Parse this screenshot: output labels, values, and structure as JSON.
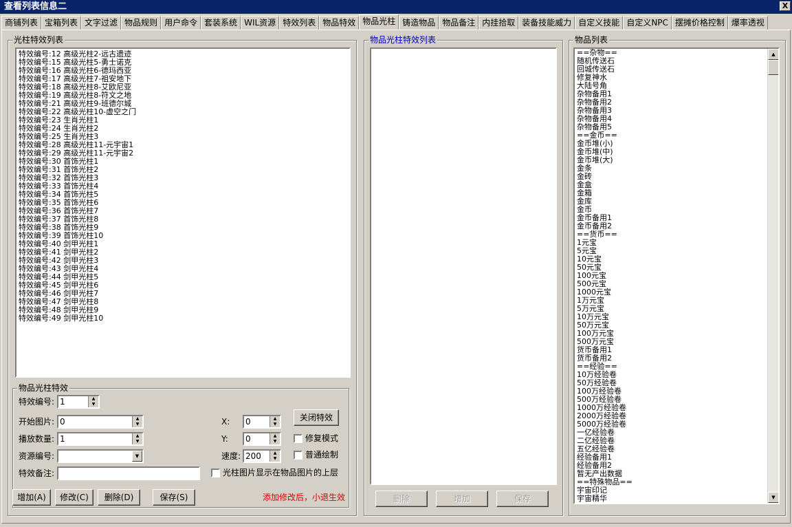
{
  "window": {
    "title": "查看列表信息二",
    "close_label": "X"
  },
  "tabs": [
    {
      "label": "商铺列表"
    },
    {
      "label": "宝箱列表"
    },
    {
      "label": "文字过滤"
    },
    {
      "label": "物品规则"
    },
    {
      "label": "用户命令"
    },
    {
      "label": "套装系统"
    },
    {
      "label": "WIL资源"
    },
    {
      "label": "特效列表"
    },
    {
      "label": "物品特效"
    },
    {
      "label": "物品光柱",
      "active": true
    },
    {
      "label": "铸造物品"
    },
    {
      "label": "物品备注"
    },
    {
      "label": "内挂拾取"
    },
    {
      "label": "装备技能威力"
    },
    {
      "label": "自定义技能"
    },
    {
      "label": "自定义NPC"
    },
    {
      "label": "摆摊价格控制"
    },
    {
      "label": "爆率透视"
    }
  ],
  "left": {
    "group_title": "光柱特效列表",
    "items": [
      "特效编号:12 高级光柱2-远古遗迹",
      "特效编号:15 高级光柱5-勇士诺克",
      "特效编号:16 高级光柱6-德玛西亚",
      "特效编号:17 高级光柱7-祖安地下",
      "特效编号:18 高级光柱8-艾欧尼亚",
      "特效编号:19 高级光柱8-符文之地",
      "特效编号:21 高级光柱9-班德尔城",
      "特效编号:22 高级光柱10-虚空之门",
      "特效编号:23 生肖光柱1",
      "特效编号:24 生肖光柱2",
      "特效编号:25 生肖光柱3",
      "特效编号:28 高级光柱11-元宇宙1",
      "特效编号:29 高级光柱11-元宇宙2",
      "特效编号:30 首饰光柱1",
      "特效编号:31 首饰光柱2",
      "特效编号:32 首饰光柱3",
      "特效编号:33 首饰光柱4",
      "特效编号:34 首饰光柱5",
      "特效编号:35 首饰光柱6",
      "特效编号:36 首饰光柱7",
      "特效编号:37 首饰光柱8",
      "特效编号:38 首饰光柱9",
      "特效编号:39 首饰光柱10",
      "特效编号:40 剑甲光柱1",
      "特效编号:41 剑甲光柱2",
      "特效编号:42 剑甲光柱3",
      "特效编号:43 剑甲光柱4",
      "特效编号:44 剑甲光柱5",
      "特效编号:45 剑甲光柱6",
      "特效编号:46 剑甲光柱7",
      "特效编号:47 剑甲光柱8",
      "特效编号:48 剑甲光柱9",
      "特效编号:49 剑甲光柱10"
    ]
  },
  "form": {
    "group_title": "物品光柱特效",
    "effect_id_label": "特效编号:",
    "effect_id_value": "1",
    "start_image_label": "开始图片:",
    "start_image_value": "0",
    "play_count_label": "播放数量:",
    "play_count_value": "1",
    "resource_id_label": "资源编号:",
    "resource_id_value": "",
    "remark_label": "特效备注:",
    "remark_value": "",
    "x_label": "X:",
    "x_value": "0",
    "y_label": "Y:",
    "y_value": "0",
    "speed_label": "速度:",
    "speed_value": "200",
    "close_effect_label": "关闭特效",
    "repair_mode_label": "修复模式",
    "normal_draw_label": "普通绘制",
    "top_layer_label": "光柱图片显示在物品图片的上层",
    "add_label": "增加(A)",
    "modify_label": "修改(C)",
    "delete_label": "删除(D)",
    "save_label": "保存(S)",
    "warning": "添加修改后，小退生效"
  },
  "middle": {
    "group_title": "物品光柱特效列表",
    "delete_label": "删除",
    "add_label": "增加",
    "save_label": "保存"
  },
  "right": {
    "group_title": "物品列表",
    "items": [
      "==杂物==",
      "随机传送石",
      "回城传送石",
      "修复神水",
      "大陆号角",
      "杂物备用1",
      "杂物备用2",
      "杂物备用3",
      "杂物备用4",
      "杂物备用5",
      "==金币==",
      "金币堆(小)",
      "金币堆(中)",
      "金币堆(大)",
      "金条",
      "金砖",
      "金盒",
      "金箱",
      "金库",
      "金币",
      "金币备用1",
      "金币备用2",
      "==货币==",
      "1元宝",
      "5元宝",
      "10元宝",
      "50元宝",
      "100元宝",
      "500元宝",
      "1000元宝",
      "1万元宝",
      "5万元宝",
      "10万元宝",
      "50万元宝",
      "100万元宝",
      "500万元宝",
      "货币备用1",
      "货币备用2",
      "==经验==",
      "10万经验卷",
      "50万经验卷",
      "100万经验卷",
      "500万经验卷",
      "1000万经验卷",
      "2000万经验卷",
      "5000万经验卷",
      "一亿经验卷",
      "二亿经验卷",
      "五亿经验卷",
      "经验备用1",
      "经验备用2",
      "暂无产出数据",
      "==特殊物品==",
      "宇宙印记",
      "宇宙精华"
    ]
  }
}
